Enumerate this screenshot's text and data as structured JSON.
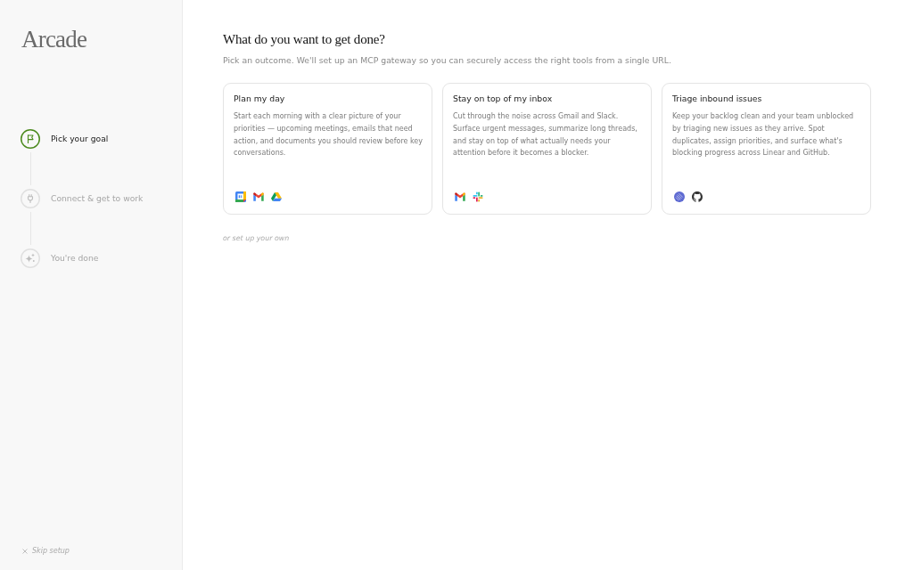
{
  "sidebar": {
    "logo": "Arcade",
    "steps": [
      {
        "label": "Pick your goal",
        "current": true
      },
      {
        "label": "Connect & get to work",
        "current": false
      },
      {
        "label": "You're done",
        "current": false
      }
    ],
    "skip_link": "Skip setup"
  },
  "main": {
    "heading": "What do you want to get done?",
    "subtitle": "Pick an outcome. We'll set up an MCP gateway so you can securely access the right tools from a single URL.",
    "cards": [
      {
        "title": "Plan my day",
        "description": "Start each morning with a clear picture of your priorities — upcoming meetings, emails that need action, and documents you should review before key conversations.",
        "apps": [
          {
            "kind": "calendar"
          },
          {
            "kind": "mail"
          },
          {
            "kind": "drive"
          }
        ]
      },
      {
        "title": "Stay on top of my inbox",
        "description": "Cut through the noise across Gmail and Slack. Surface urgent messages, summarize long threads, and stay on top of what actually needs your attention before it becomes a blocker.",
        "apps": [
          {
            "kind": "mail"
          },
          {
            "kind": "chat"
          }
        ]
      },
      {
        "title": "Triage inbound issues",
        "description": "Keep your backlog clean and your team unblocked by triaging new issues as they arrive. Spot duplicates, assign priorities, and surface what's blocking progress across Linear and GitHub.",
        "apps": [
          {
            "kind": "tracker"
          },
          {
            "kind": "code"
          }
        ]
      }
    ],
    "custom_link": "or set up your own"
  }
}
